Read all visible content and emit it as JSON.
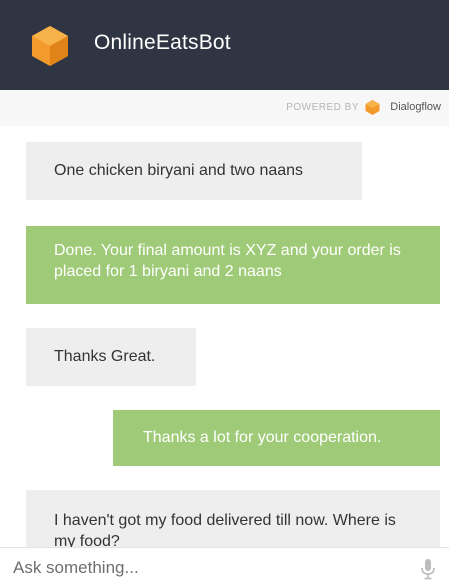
{
  "header": {
    "bot_name": "OnlineEatsBot",
    "logo_icon": "orange-cube-icon",
    "background": "#2f3542"
  },
  "powered_by": {
    "label": "POWERED BY",
    "brand": "Dialogflow",
    "brand_icon": "dialogflow-icon"
  },
  "messages": [
    {
      "sender": "user",
      "text": "One chicken biryani and two naans"
    },
    {
      "sender": "bot",
      "text": "Done. Your final amount is XYZ and your order is placed for 1 biryani and 2 naans"
    },
    {
      "sender": "user",
      "text": "Thanks Great."
    },
    {
      "sender": "bot",
      "text": "Thanks a lot for your cooperation."
    },
    {
      "sender": "user",
      "text": "I haven't got my food delivered till now. Where is my food?"
    }
  ],
  "input": {
    "placeholder": "Ask something...",
    "value": "",
    "mic_icon": "microphone-icon"
  },
  "colors": {
    "bot_bubble": "#9fcb78",
    "user_bubble": "#eeeeee",
    "accent_orange": "#f39a2d"
  }
}
